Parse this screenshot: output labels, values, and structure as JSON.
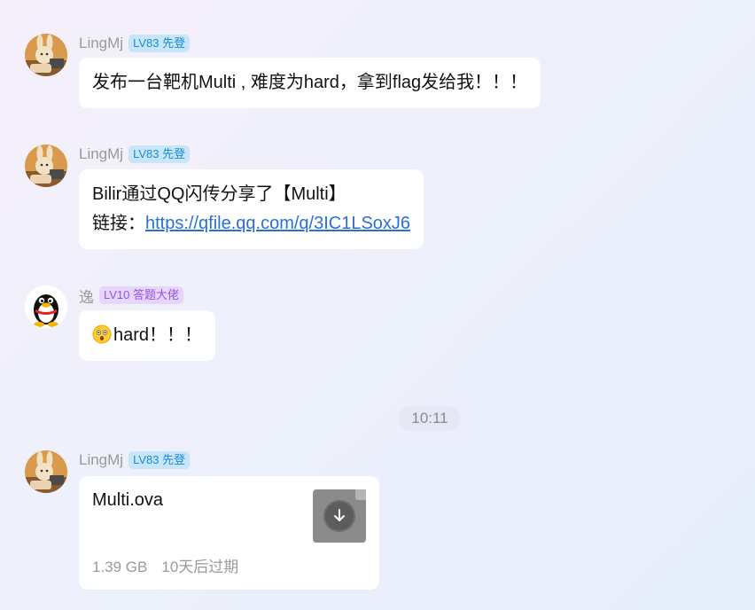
{
  "messages": [
    {
      "nick": "LingMj",
      "badge": "LV83 先登",
      "text": "发布一台靶机Multi , 难度为hard，拿到flag发给我！！！"
    },
    {
      "nick": "LingMj",
      "badge": "LV83 先登",
      "line1": "Bilir通过QQ闪传分享了【Multi】",
      "link_label": "链接：",
      "link_url": "https://qfile.qq.com/q/3IC1LSoxJ6"
    },
    {
      "nick": "逸",
      "badge": "LV10 答题大佬",
      "emoji": "astonished-face-emoji",
      "text": "hard！！！"
    },
    {
      "nick": "LingMj",
      "badge": "LV83 先登",
      "file": {
        "name": "Multi.ova",
        "size": "1.39 GB",
        "expiry": "10天后过期",
        "icon": "download-icon"
      }
    }
  ],
  "timestamp": "10:11",
  "colors": {
    "badge_blue_bg": "#c7e6fa",
    "badge_blue_text": "#1b8ad8",
    "badge_purple_bg": "#e6d6fb",
    "badge_purple_text": "#9654e6",
    "link": "#2a6fd6"
  }
}
